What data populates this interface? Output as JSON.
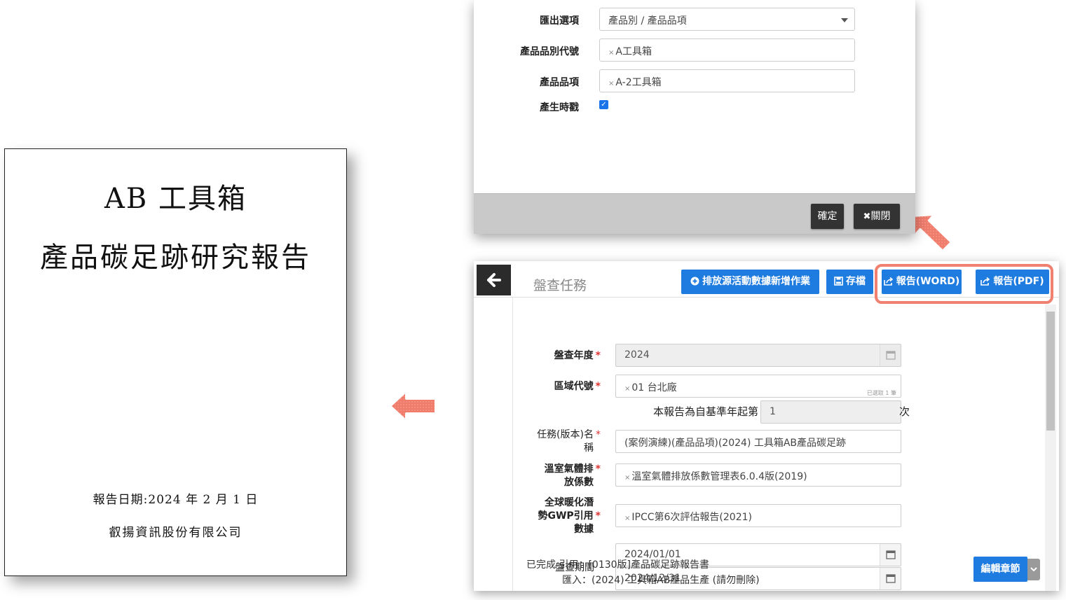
{
  "report_cover": {
    "title_line1": "AB 工具箱",
    "title_line2": "產品碳足跡研究報告",
    "date_line": "報告日期:2024 年 2 月 1 日",
    "company": "叡揚資訊股份有限公司"
  },
  "export_dialog": {
    "fields": [
      {
        "label": "匯出選項",
        "value": "產品別 / 產品品項",
        "type": "select"
      },
      {
        "label": "產品品別代號",
        "value": "A工具箱",
        "type": "tag"
      },
      {
        "label": "產品品項",
        "value": "A-2工具箱",
        "type": "tag"
      }
    ],
    "timestamp_label": "產生時戳",
    "timestamp_checked": true,
    "confirm_button": "確定",
    "close_button": "關閉"
  },
  "main_panel": {
    "title": "盤查任務",
    "buttons": {
      "add_activity": "排放源活動數據新增作業",
      "save": "存檔",
      "report_word": "報告(WORD)",
      "report_pdf": "報告(PDF)"
    },
    "form": {
      "year_label": "盤查年度",
      "year_value": "2024",
      "region_label": "區域代號",
      "region_value": "01 台北廠",
      "region_note": "已選取 1 筆",
      "base_year_prefix": "本報告為自基準年起第",
      "base_year_value": "1",
      "base_year_suffix": "次",
      "task_label_1": "任務(版本)名",
      "task_label_2": "稱",
      "task_value": "(案例演練)(產品品項)(2024) 工具箱AB產品碳足跡",
      "ef_label_1": "溫室氣體排",
      "ef_label_2": "放係數",
      "ef_value": "溫室氣體排放係數管理表6.0.4版(2019)",
      "gwp_label_1": "全球暖化潛",
      "gwp_label_2": "勢GWP引用",
      "gwp_label_3": "數據",
      "gwp_value": "IPCC第6次評估報告(2021)",
      "period_label": "盤查期間",
      "period_start": "2024/01/01",
      "period_end": "2024/12/31",
      "status_line1": "已完成 引用：[0130版]產品碳足跡報告書",
      "status_line2": "匯入：(2024) 工具箱AB產品生產 (請勿刪除)",
      "edit_chapter_button": "編輯章節"
    }
  },
  "colors": {
    "accent_blue": "#1e7be0",
    "highlight_coral": "#f08170",
    "dark_button": "#333333"
  }
}
